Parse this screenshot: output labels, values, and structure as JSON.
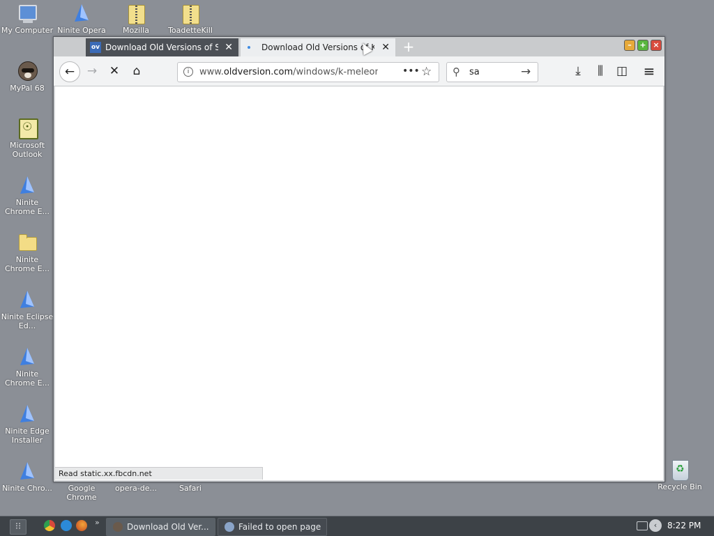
{
  "desktop": {
    "icons": [
      {
        "label": "My Computer",
        "icon": "computer-icon"
      },
      {
        "label": "MyPal 68",
        "icon": "mypal-icon"
      },
      {
        "label": "Microsoft Outlook",
        "icon": "outlook-icon"
      },
      {
        "label": "Ninite Chrome E...",
        "icon": "ninite-icon"
      },
      {
        "label": "Ninite Chrome E...",
        "icon": "folder-icon"
      },
      {
        "label": "Ninite Eclipse Ed...",
        "icon": "ninite-icon"
      },
      {
        "label": "Ninite Chrome E...",
        "icon": "ninite-icon"
      },
      {
        "label": "Ninite Edge Installer",
        "icon": "ninite-icon"
      },
      {
        "label": "Ninite Chro...",
        "icon": "ninite-icon"
      },
      {
        "label": "Ninite Opera",
        "icon": "ninite-icon"
      },
      {
        "label": "Mozilla",
        "icon": "zip-folder-icon"
      },
      {
        "label": "ToadetteKill",
        "icon": "zip-folder-icon"
      },
      {
        "label": "Google Chrome",
        "icon": "none"
      },
      {
        "label": "opera-de...",
        "icon": "none"
      },
      {
        "label": "Safari",
        "icon": "none"
      },
      {
        "label": "Recycle Bin",
        "icon": "recycle-bin-icon"
      }
    ]
  },
  "browser": {
    "tabs": [
      {
        "label": "Download Old Versions of Se",
        "favicon": "ov",
        "close": "✕"
      },
      {
        "label": "Download Old Versions of K-",
        "close": "✕"
      }
    ],
    "new_tab": "+",
    "window_buttons": {
      "minimize": "–",
      "maximize": "+",
      "close": "×"
    },
    "nav": {
      "back": "←",
      "forward": "→",
      "stop": "✕",
      "home": "⌂"
    },
    "url": {
      "prefix": "www.",
      "domain": "oldversion.com",
      "path": "/windows/k-meleon",
      "info": "i",
      "more": "•••",
      "bookmark": "☆"
    },
    "search": {
      "icon": "⚲",
      "value": "sa",
      "go": "→"
    },
    "toolbar": {
      "download": "⤓",
      "library": "⫼",
      "sidebar": "◫",
      "menu": "≡"
    },
    "status": "Read static.xx.fbcdn.net"
  },
  "taskbar": {
    "start": "⁝⁝",
    "more": "»",
    "tasks": [
      {
        "label": "Download Old Ver..."
      },
      {
        "label": "Failed to open page"
      }
    ],
    "tray_arrow": "‹",
    "clock": "8:22 PM"
  },
  "colors": {
    "desktop": "#8b8f96",
    "taskbar": "#3d4247",
    "active_tab": "#4c5056"
  }
}
